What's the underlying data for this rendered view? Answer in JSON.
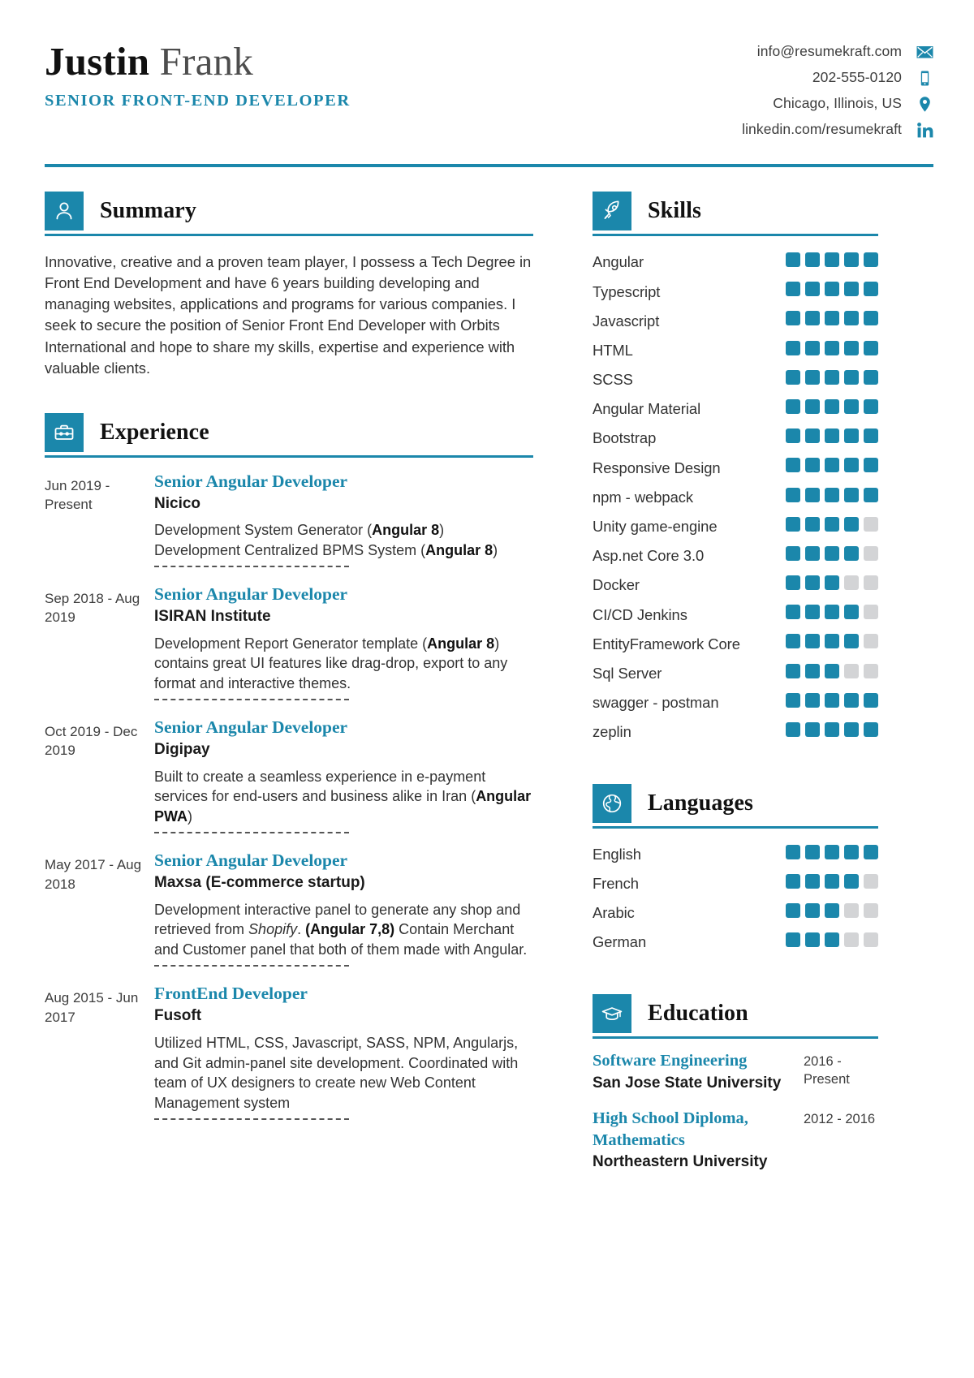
{
  "colors": {
    "accent": "#1b87ab",
    "dot_off": "#d3d4d6",
    "text": "#333333"
  },
  "header": {
    "first_name": "Justin",
    "last_name": " Frank",
    "job_title": "SENIOR FRONT-END DEVELOPER",
    "contacts": [
      {
        "icon": "envelope-icon",
        "text": "info@resumekraft.com"
      },
      {
        "icon": "phone-icon",
        "text": "202-555-0120"
      },
      {
        "icon": "location-pin-icon",
        "text": "Chicago, Illinois, US"
      },
      {
        "icon": "linkedin-icon",
        "text": "linkedin.com/resumekraft"
      }
    ]
  },
  "summary": {
    "icon": "person-icon",
    "title": "Summary",
    "text": "Innovative, creative and a proven team player, I possess a Tech Degree in Front End Development and have 6 years building developing and managing websites, applications and programs for various companies. I seek to secure the position of Senior Front End Developer with Orbits International and hope to share my skills, expertise and experience with valuable clients."
  },
  "experience": {
    "icon": "briefcase-icon",
    "title": "Experience",
    "items": [
      {
        "dates": "Jun 2019 - Present",
        "role": "Senior Angular Developer",
        "company": "Nicico",
        "description_html": "Development System Generator (<b>Angular 8</b>)<br>Development Centralized BPMS System (<b>Angular 8</b>)"
      },
      {
        "dates": "Sep 2018 - Aug 2019",
        "role": "Senior Angular Developer",
        "company": "ISIRAN Institute",
        "description_html": "Development Report Generator template (<b>Angular 8</b>) contains great UI features like drag-drop, export to any format and interactive themes."
      },
      {
        "dates": "Oct 2019 - Dec 2019",
        "role": "Senior Angular Developer",
        "company": "Digipay",
        "description_html": "Built to create a seamless experience in e-payment services for end-users and business alike in Iran (<b>Angular PWA</b>)"
      },
      {
        "dates": "May 2017 - Aug 2018",
        "role": "Senior Angular Developer",
        "company": "Maxsa (E-commerce startup)",
        "description_html": "Development interactive panel to generate any shop and retrieved from <i>Shopify</i>. <b>(Angular 7,8)</b> Contain Merchant and Customer panel that both of them made with Angular."
      },
      {
        "dates": "Aug 2015 - Jun 2017",
        "role": "FrontEnd Developer",
        "company": "Fusoft",
        "description_html": "Utilized HTML, CSS, Javascript, SASS, NPM, Angularjs, and Git admin-panel site development. Coordinated with team of UX designers to create new Web Content Management system"
      }
    ]
  },
  "skills": {
    "icon": "rocket-icon",
    "title": "Skills",
    "max_rating": 5,
    "items": [
      {
        "label": "Angular",
        "rating": 5
      },
      {
        "label": "Typescript",
        "rating": 5
      },
      {
        "label": "Javascript",
        "rating": 5
      },
      {
        "label": "HTML",
        "rating": 5
      },
      {
        "label": "SCSS",
        "rating": 5
      },
      {
        "label": "Angular Material",
        "rating": 5
      },
      {
        "label": "Bootstrap",
        "rating": 5
      },
      {
        "label": "Responsive Design",
        "rating": 5
      },
      {
        "label": "npm - webpack",
        "rating": 5
      },
      {
        "label": "Unity game-engine",
        "rating": 4
      },
      {
        "label": "Asp.net Core 3.0",
        "rating": 4
      },
      {
        "label": "Docker",
        "rating": 3
      },
      {
        "label": "CI/CD Jenkins",
        "rating": 4
      },
      {
        "label": "EntityFramework Core",
        "rating": 4
      },
      {
        "label": "Sql Server",
        "rating": 3
      },
      {
        "label": "swagger - postman",
        "rating": 5
      },
      {
        "label": "zeplin",
        "rating": 5
      }
    ]
  },
  "languages": {
    "icon": "globe-icon",
    "title": "Languages",
    "max_rating": 5,
    "items": [
      {
        "label": "English",
        "rating": 5
      },
      {
        "label": "French",
        "rating": 4
      },
      {
        "label": "Arabic",
        "rating": 3
      },
      {
        "label": "German",
        "rating": 3
      }
    ]
  },
  "education": {
    "icon": "graduation-cap-icon",
    "title": "Education",
    "items": [
      {
        "degree": "Software Engineering",
        "school": "San Jose State University",
        "dates": "2016 - Present"
      },
      {
        "degree": "High School Diploma, Mathematics",
        "school": "Northeastern University",
        "dates": "2012 - 2016"
      }
    ]
  }
}
